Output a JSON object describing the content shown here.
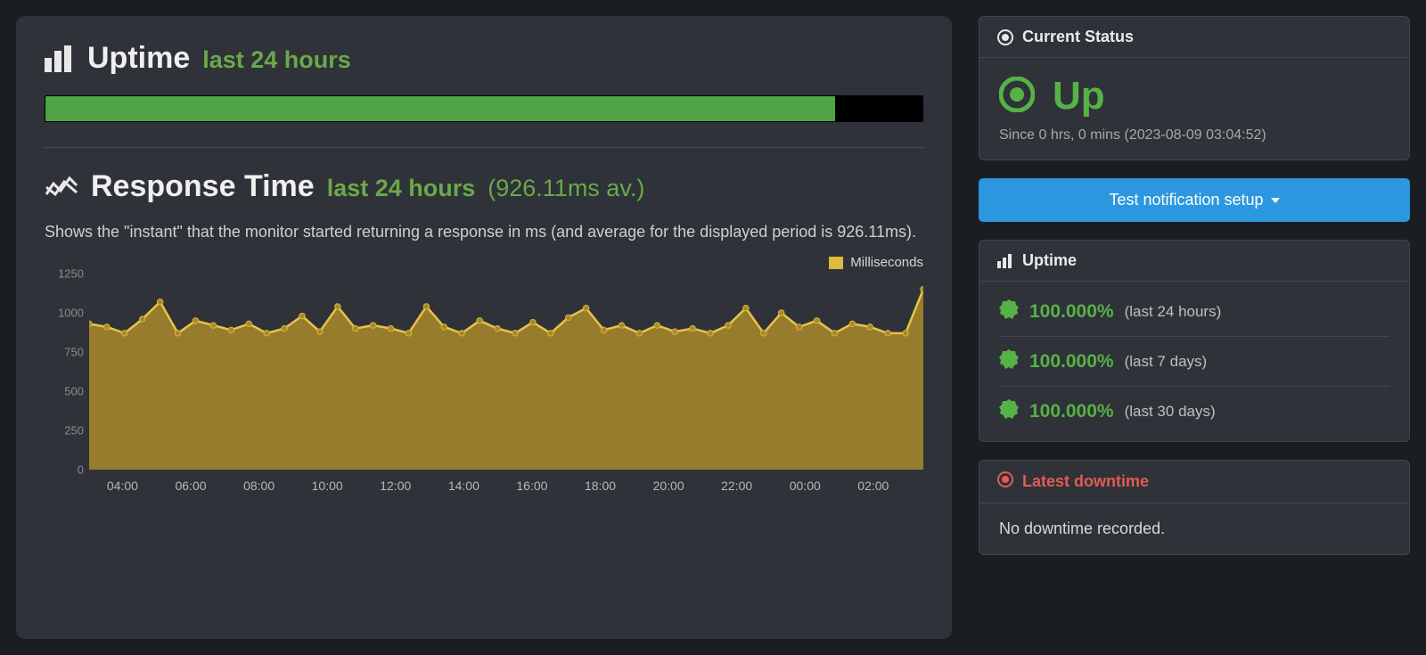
{
  "uptime": {
    "title": "Uptime",
    "subtitle": "last 24 hours",
    "bar_percent": 90
  },
  "response": {
    "title": "Response Time",
    "subtitle": "last 24 hours",
    "avg_label": "(926.11ms av.)",
    "description": "Shows the \"instant\" that the monitor started returning a response in ms (and average for the displayed period is 926.11ms).",
    "legend": "Milliseconds"
  },
  "status": {
    "header": "Current Status",
    "state": "Up",
    "since": "Since 0 hrs, 0 mins (2023-08-09 03:04:52)"
  },
  "test_button": "Test notification setup",
  "uptime_panel": {
    "header": "Uptime",
    "rows": [
      {
        "pct": "100.000%",
        "range": "(last 24 hours)"
      },
      {
        "pct": "100.000%",
        "range": "(last 7 days)"
      },
      {
        "pct": "100.000%",
        "range": "(last 30 days)"
      }
    ]
  },
  "downtime": {
    "header": "Latest downtime",
    "body": "No downtime recorded."
  },
  "chart_data": {
    "type": "area",
    "title": "Response Time",
    "xlabel": "",
    "ylabel": "Milliseconds",
    "ylim": [
      0,
      1250
    ],
    "y_ticks": [
      0,
      250,
      500,
      750,
      1000,
      1250
    ],
    "x_ticks": [
      "04:00",
      "06:00",
      "08:00",
      "10:00",
      "12:00",
      "14:00",
      "16:00",
      "18:00",
      "20:00",
      "22:00",
      "00:00",
      "02:00"
    ],
    "x": [
      "03:00",
      "03:30",
      "04:00",
      "04:30",
      "05:00",
      "05:30",
      "06:00",
      "06:30",
      "07:00",
      "07:30",
      "08:00",
      "08:30",
      "09:00",
      "09:30",
      "10:00",
      "10:30",
      "11:00",
      "11:30",
      "12:00",
      "12:30",
      "13:00",
      "13:30",
      "14:00",
      "14:30",
      "15:00",
      "15:30",
      "16:00",
      "16:30",
      "17:00",
      "17:30",
      "18:00",
      "18:30",
      "19:00",
      "19:30",
      "20:00",
      "20:30",
      "21:00",
      "21:30",
      "22:00",
      "22:30",
      "23:00",
      "23:30",
      "00:00",
      "00:30",
      "01:00",
      "01:30",
      "02:00",
      "03:00"
    ],
    "values": [
      930,
      910,
      870,
      960,
      1070,
      870,
      950,
      920,
      890,
      930,
      870,
      900,
      980,
      880,
      1040,
      900,
      920,
      900,
      870,
      1040,
      910,
      870,
      950,
      900,
      870,
      940,
      870,
      970,
      1030,
      890,
      920,
      870,
      920,
      880,
      900,
      870,
      920,
      1030,
      870,
      1000,
      910,
      950,
      870,
      930,
      910,
      870,
      870,
      1150
    ],
    "series": [
      {
        "name": "Milliseconds",
        "color": "#e0ba3a"
      }
    ]
  }
}
